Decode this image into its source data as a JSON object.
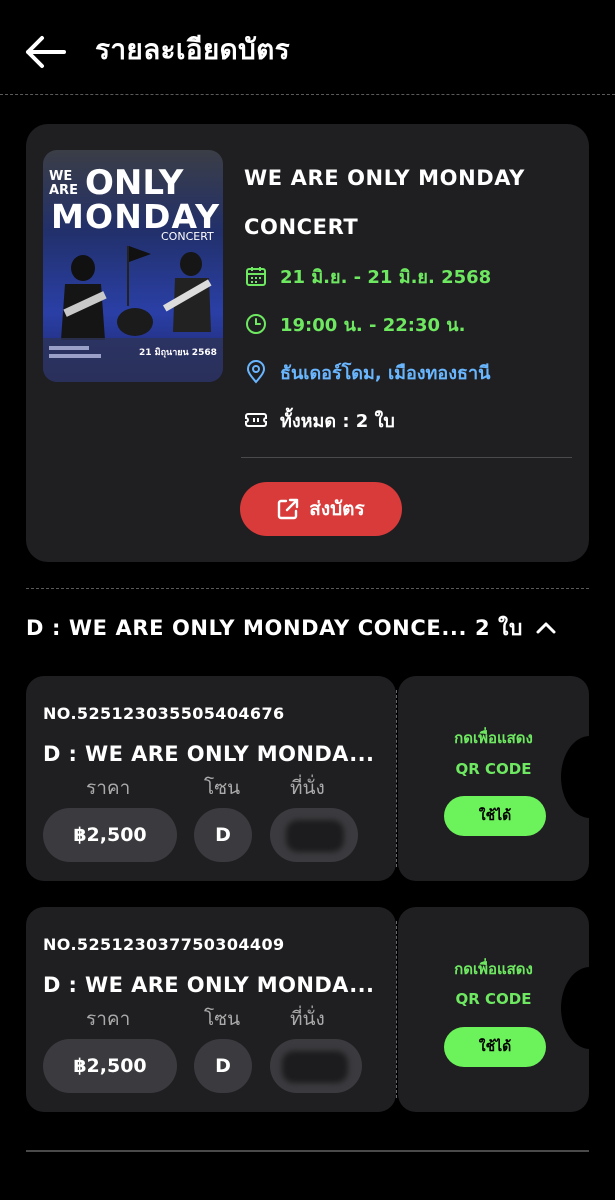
{
  "header": {
    "title": "รายละเอียดบัตร",
    "back_icon": "arrow-left-icon"
  },
  "event": {
    "poster": {
      "line1": "WE",
      "line2": "ARE",
      "line3": "ONLY",
      "line4": "MONDAY",
      "line5": "CONCERT",
      "date_text": "21 มิถุนายน 2568"
    },
    "title_line1": "WE ARE ONLY MONDAY",
    "title_line2": "CONCERT",
    "date": "21 มิ.ย. - 21 มิ.ย. 2568",
    "time": "19:00 น. - 22:30 น.",
    "venue": "ธันเดอร์โดม, เมืองทองธานี",
    "total": "ทั้งหมด : 2 ใบ",
    "send_label": "ส่งบัตร",
    "colors": {
      "date": "#6ee860",
      "venue": "#69b6ff",
      "send": "#d93a3a"
    }
  },
  "group": {
    "title": "D : WE ARE ONLY MONDAY CONCE... 2 ใบ",
    "chevron_icon": "chevron-up-icon"
  },
  "labels": {
    "price": "ราคา",
    "zone": "โซน",
    "seat": "ที่นั่ง"
  },
  "tickets": [
    {
      "number": "NO.525123035505404676",
      "name": "D : WE ARE ONLY MONDA...",
      "price": "฿2,500",
      "zone": "D",
      "qr_line1": "กดเพื่อแสดง",
      "qr_line2": "QR CODE",
      "use_label": "ใช้ได้"
    },
    {
      "number": "NO.525123037750304409",
      "name": "D : WE ARE ONLY MONDA...",
      "price": "฿2,500",
      "zone": "D",
      "qr_line1": "กดเพื่อแสดง",
      "qr_line2": "QR CODE",
      "use_label": "ใช้ได้"
    }
  ]
}
